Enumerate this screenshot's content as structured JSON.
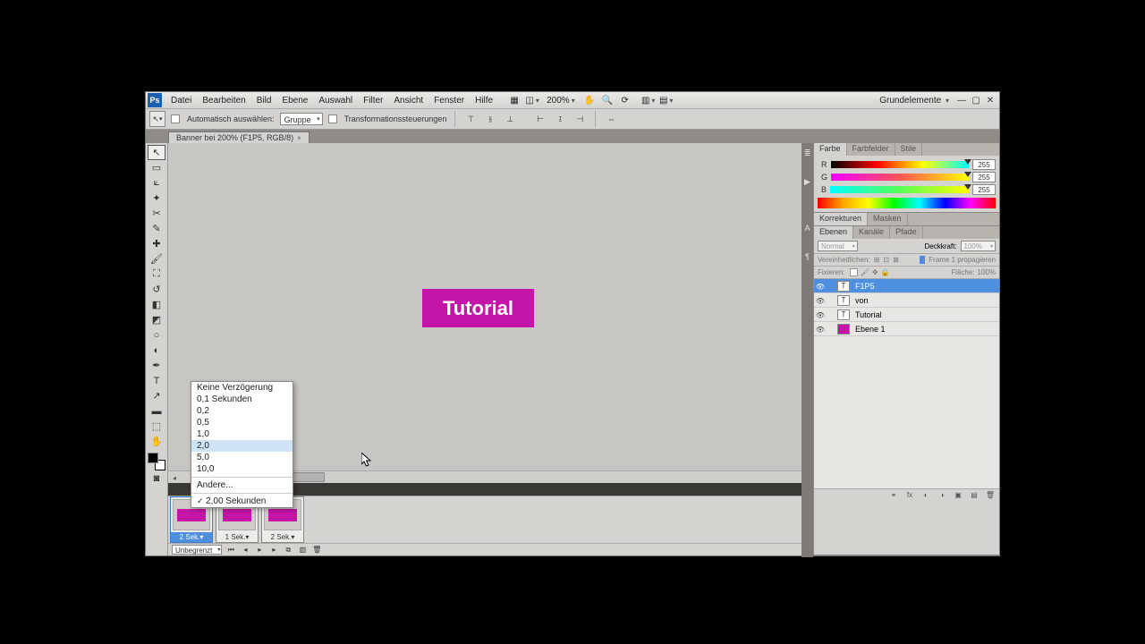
{
  "menu": {
    "items": [
      "Datei",
      "Bearbeiten",
      "Bild",
      "Ebene",
      "Auswahl",
      "Filter",
      "Ansicht",
      "Fenster",
      "Hilfe"
    ],
    "zoom": "200%",
    "workspace": "Grundelemente"
  },
  "options": {
    "autoSelect": "Automatisch auswählen:",
    "group": "Gruppe",
    "transformCtrls": "Transformationssteuerungen"
  },
  "docTab": "Banner bei 200% (F1P5, RGB/8)",
  "canvasText": "Tutorial",
  "frames": [
    {
      "delay": "2 Sek.",
      "selected": true
    },
    {
      "delay": "1 Sek.",
      "selected": false
    },
    {
      "delay": "2 Sek.",
      "selected": false
    }
  ],
  "animFooter": {
    "loop": "Unbegrenzt"
  },
  "popup": {
    "items": [
      "Keine Verzögerung",
      "0,1 Sekunden",
      "0,2",
      "0,5",
      "1,0",
      "2,0",
      "5,0",
      "10,0"
    ],
    "other": "Andere...",
    "current": "2,00 Sekunden",
    "hlIndex": 5
  },
  "panels": {
    "color": {
      "tabs": [
        "Farbe",
        "Farbfelder",
        "Stile"
      ],
      "channels": [
        "R",
        "G",
        "B"
      ],
      "values": [
        "255",
        "255",
        "255"
      ]
    },
    "adjust": {
      "tabs": [
        "Korrekturen",
        "Masken"
      ]
    },
    "layers": {
      "tabs": [
        "Ebenen",
        "Kanäle",
        "Pfade"
      ],
      "blend": "Normal",
      "opacityLbl": "Deckkraft:",
      "opacity": "100%",
      "unifyLbl": "Vereinheitlichen:",
      "propagate": "Frame 1 propagieren",
      "lockLbl": "Fixieren:",
      "fillLbl": "Fläche:",
      "fill": "100%",
      "rows": [
        {
          "type": "T",
          "name": "F1P5",
          "selected": true
        },
        {
          "type": "T",
          "name": "von",
          "selected": false
        },
        {
          "type": "T",
          "name": "Tutorial",
          "selected": false
        },
        {
          "type": "pink",
          "name": "Ebene 1",
          "selected": false
        }
      ]
    }
  }
}
